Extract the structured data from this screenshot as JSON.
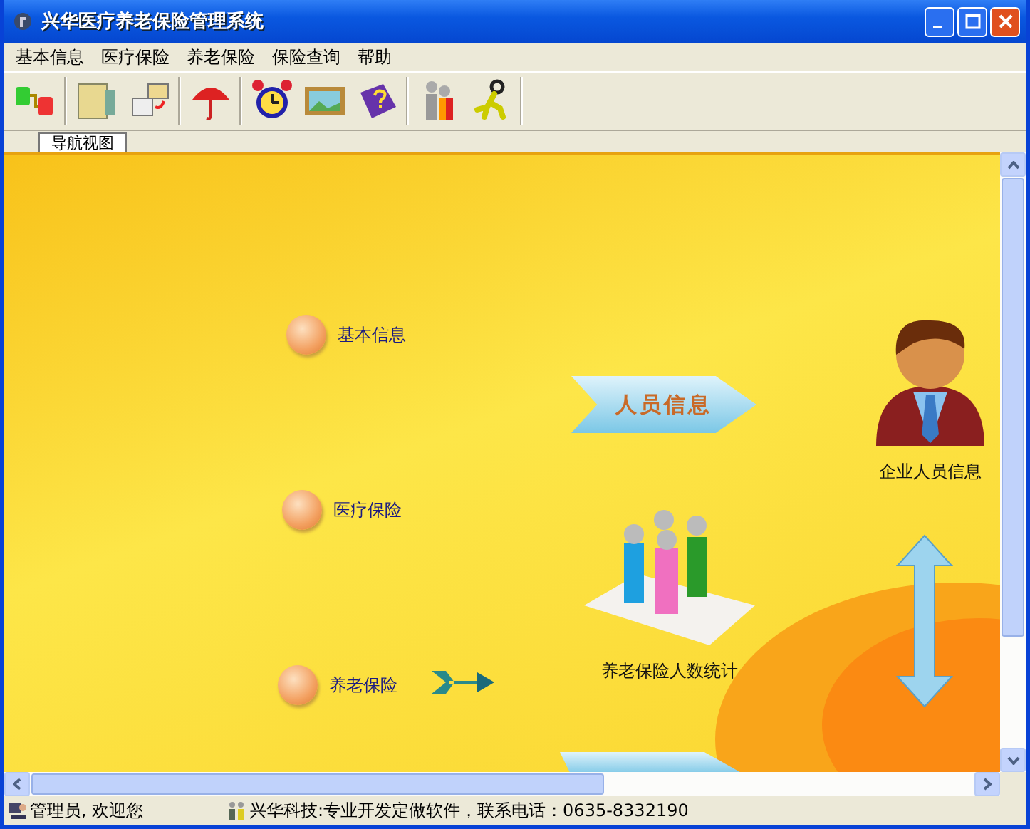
{
  "window": {
    "title": "兴华医疗养老保险管理系统"
  },
  "menu": [
    "基本信息",
    "医疗保险",
    "养老保险",
    "保险查询",
    "帮助"
  ],
  "tabs": [
    {
      "label": "导航视图",
      "selected": true
    }
  ],
  "nav_items": [
    {
      "label": "基本信息"
    },
    {
      "label": "医疗保险"
    },
    {
      "label": "养老保险"
    }
  ],
  "banners": [
    {
      "label": "人员信息"
    }
  ],
  "figures": [
    {
      "kind": "person",
      "label": "企业人员信息"
    },
    {
      "kind": "group",
      "label": "养老保险人数统计"
    }
  ],
  "status_bar": [
    "管理员, 欢迎您",
    "兴华科技:专业开发定做软件，联系电话：0635-8332190"
  ]
}
